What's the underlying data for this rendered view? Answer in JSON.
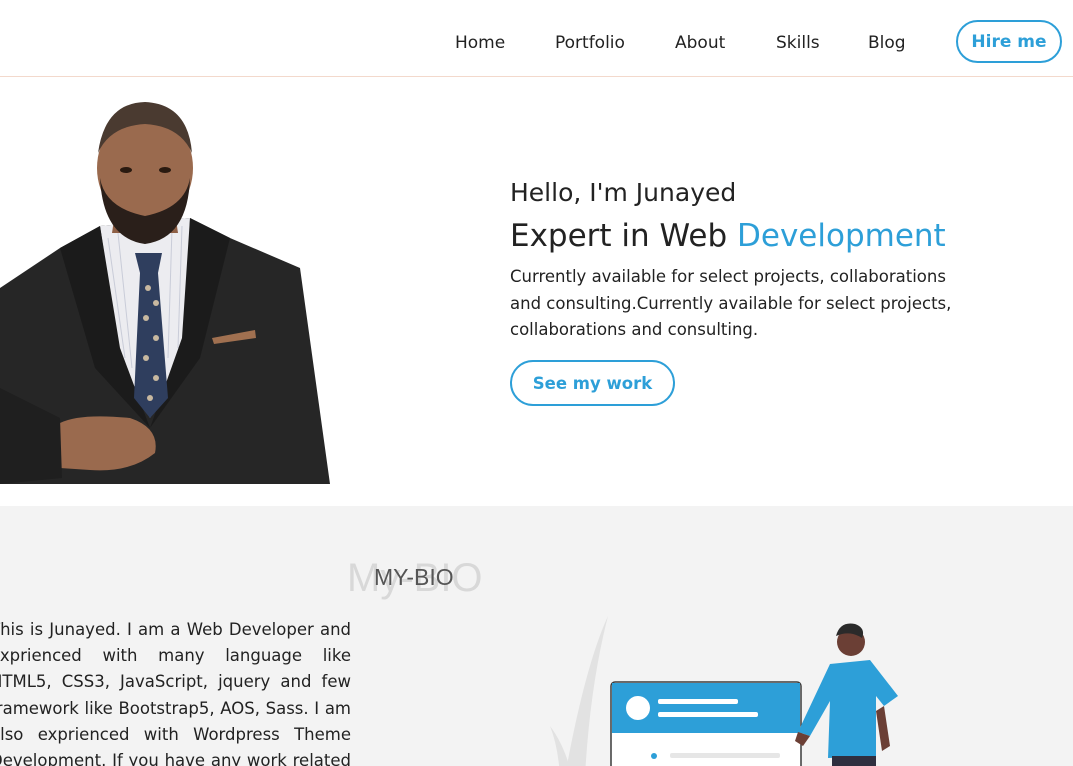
{
  "nav": {
    "items": [
      {
        "label": "Home"
      },
      {
        "label": "Portfolio"
      },
      {
        "label": "About"
      },
      {
        "label": "Skills"
      },
      {
        "label": "Blog"
      }
    ],
    "cta": "Hire me"
  },
  "hero": {
    "greeting": "Hello, I'm Junayed",
    "headline_prefix": "Expert in Web ",
    "headline_accent": "Development",
    "description": "Currently available for select projects, collaborations and consulting.Currently available for select projects, collaborations and consulting.",
    "button": "See my work"
  },
  "bio": {
    "title_shadow": "My-BIO",
    "title": "MY-BIO",
    "text": "This is Junayed. I am a Web Developer and exprienced with many language like HTML5, CSS3, JavaScript, jquery and few framework like Bootstrap5, AOS, Sass. I am also exprienced with Wordpress Theme Development. If you have any work related to the topic you can hire me"
  },
  "colors": {
    "accent": "#2d9fd8",
    "bio_bg": "#f3f3f3",
    "nav_border": "#f3d9cc"
  }
}
